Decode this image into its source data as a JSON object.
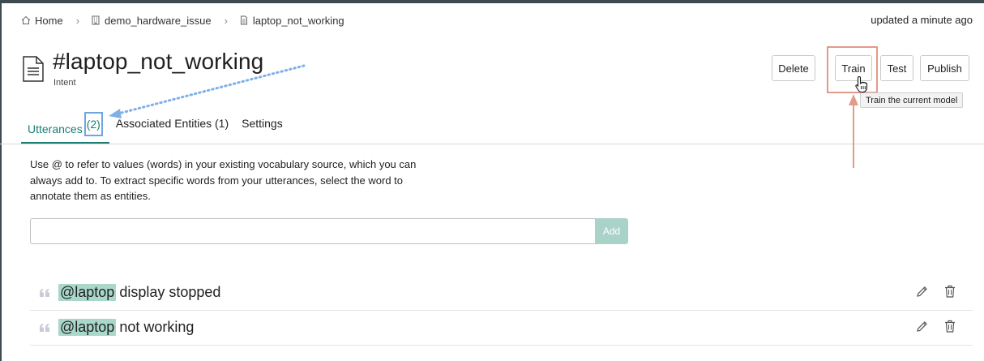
{
  "breadcrumb": {
    "home": "Home",
    "workspace": "demo_hardware_issue",
    "intent": "laptop_not_working"
  },
  "updated": "updated a minute ago",
  "header": {
    "title": "#laptop_not_working",
    "subtitle": "Intent"
  },
  "actions": {
    "delete": "Delete",
    "train": "Train",
    "test": "Test",
    "publish": "Publish",
    "train_tooltip": "Train the current model"
  },
  "tabs": {
    "utterances_label": "Utterances",
    "utterances_count": "(2)",
    "entities": "Associated Entities (1)",
    "settings": "Settings"
  },
  "help_text": "Use @ to refer to values (words) in your existing vocabulary source, which you can always add to. To extract specific words from your utterances, select the word to annotate them as entities.",
  "input": {
    "value": "",
    "placeholder": "",
    "add_label": "Add"
  },
  "utterances": [
    {
      "entity": "@laptop",
      "text": "display stopped"
    },
    {
      "entity": "@laptop",
      "text": "not working"
    }
  ],
  "colors": {
    "accent": "#1a7f72",
    "entity_highlight": "#a9d8ca",
    "annotation_blue": "#6fa6e0",
    "annotation_red": "#e39a8a"
  },
  "icons": [
    "home-icon",
    "building-icon",
    "document-icon",
    "quote-icon",
    "edit-icon",
    "trash-icon",
    "pointer-cursor-icon"
  ]
}
